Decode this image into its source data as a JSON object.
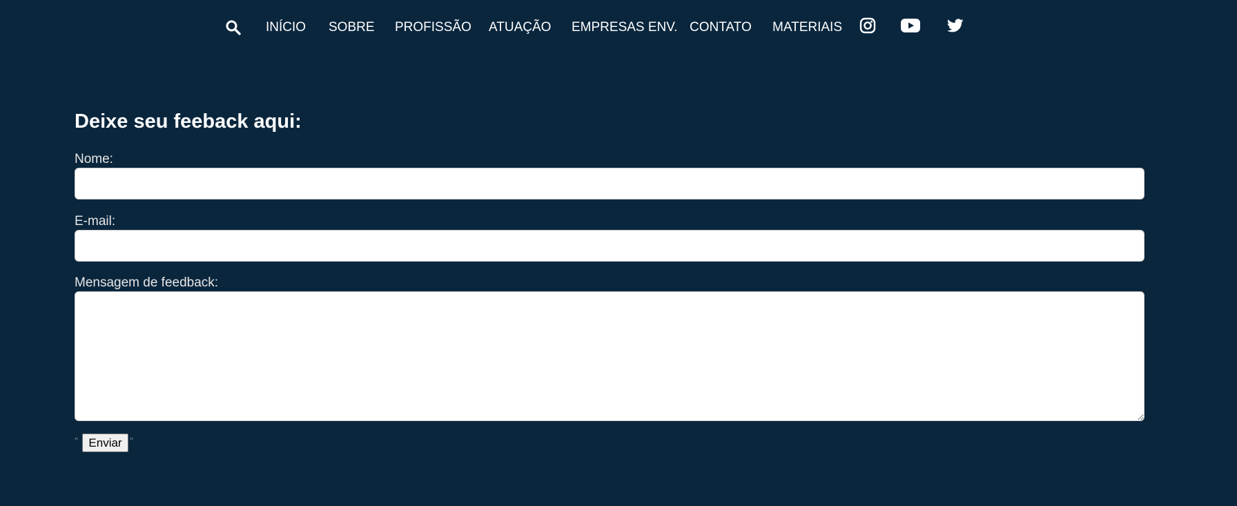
{
  "nav": {
    "search_icon": "search-icon",
    "links": [
      {
        "label": "INÍCIO"
      },
      {
        "label": "SOBRE"
      },
      {
        "label": "PROFISSÃO"
      },
      {
        "label": "ATUAÇÃO"
      },
      {
        "label": "EMPRESAS ENV."
      },
      {
        "label": "CONTATO"
      },
      {
        "label": "MATERIAIS"
      }
    ],
    "social_icons": [
      "instagram-icon",
      "youtube-icon",
      "twitter-icon"
    ]
  },
  "form": {
    "title": "Deixe seu feeback aqui:",
    "name_label": "Nome:",
    "name_value": "",
    "email_label": "E-mail:",
    "email_value": "",
    "message_label": "Mensagem de feedback:",
    "message_value": "",
    "submit_label": "Enviar",
    "quote_open": "''",
    "quote_close": "''"
  },
  "colors": {
    "background": "#0a263d",
    "text": "#ffffff",
    "label": "#e6e6e6",
    "input_background": "#ffffff"
  }
}
